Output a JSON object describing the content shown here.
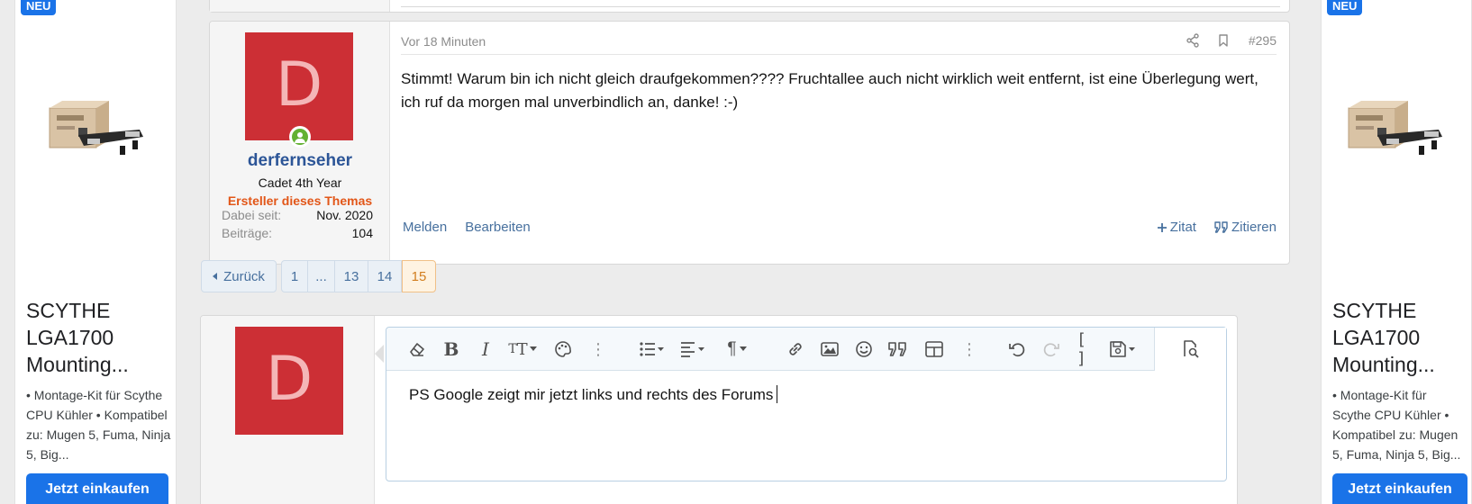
{
  "ad_left": {
    "badge": "NEU",
    "title": "SCYTHE LGA1700 Mounting...",
    "description": "• Montage-Kit für Scythe CPU Kühler • Kompatibel zu: Mugen 5, Fuma, Ninja 5, Big...",
    "button": "Jetzt einkaufen"
  },
  "ad_right": {
    "badge": "NEU",
    "title": "SCYTHE LGA1700 Mounting...",
    "description": "• Montage-Kit für Scythe CPU Kühler • Kompatibel zu: Mugen 5, Fuma, Ninja 5, Big...",
    "button": "Jetzt einkaufen"
  },
  "post": {
    "avatar_letter": "D",
    "username": "derfernseher",
    "user_title": "Cadet 4th Year",
    "thread_starter": "Ersteller dieses Themas",
    "stats": [
      {
        "label": "Dabei seit:",
        "value": "Nov. 2020"
      },
      {
        "label": "Beiträge:",
        "value": "104"
      }
    ],
    "time": "Vor 18 Minuten",
    "number": "#295",
    "body": "Stimmt! Warum bin ich nicht gleich draufgekommen???? Fruchtallee auch nicht wirklich weit entfernt, ist eine Überlegung wert, ich ruf da morgen mal unverbindlich an, danke! :-)",
    "actions_left": [
      "Melden",
      "Bearbeiten"
    ],
    "actions_right": [
      "Zitat",
      "Zitieren"
    ]
  },
  "pagination": {
    "back": "Zurück",
    "pages": [
      "1",
      "...",
      "13",
      "14",
      "15"
    ],
    "current": "15"
  },
  "reply": {
    "avatar_letter": "D",
    "text": "PS Google zeigt mir jetzt links und rechts des Forums"
  },
  "colors": {
    "avatar_bg": "#cc2f35",
    "link": "#47709e",
    "username": "#2c5597",
    "thread_starter": "#e25618",
    "ad_button": "#1a73e8",
    "online": "#63b132"
  }
}
